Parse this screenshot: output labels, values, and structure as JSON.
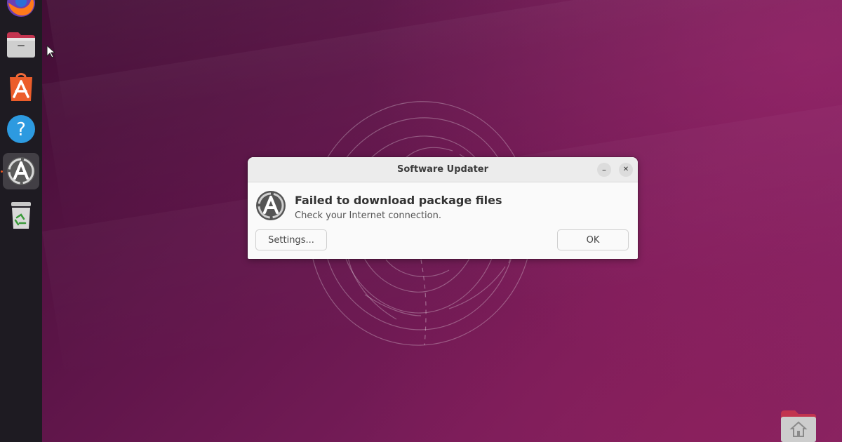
{
  "dialog": {
    "title": "Software Updater",
    "heading": "Failed to download package files",
    "message": "Check your Internet connection.",
    "settings_label": "Settings...",
    "ok_label": "OK",
    "minimize_glyph": "–",
    "close_glyph": "✕"
  },
  "dock": {
    "items": [
      {
        "name": "firefox-icon"
      },
      {
        "name": "files-icon"
      },
      {
        "name": "app-center-icon"
      },
      {
        "name": "help-icon",
        "glyph": "?"
      },
      {
        "name": "software-updater-icon",
        "active": true
      },
      {
        "name": "trash-icon"
      }
    ]
  },
  "colors": {
    "accent": "#e95420",
    "dock_bg": "#1e1b22",
    "help_blue": "#2d9ae0",
    "dialog_bg": "#fafafa"
  }
}
